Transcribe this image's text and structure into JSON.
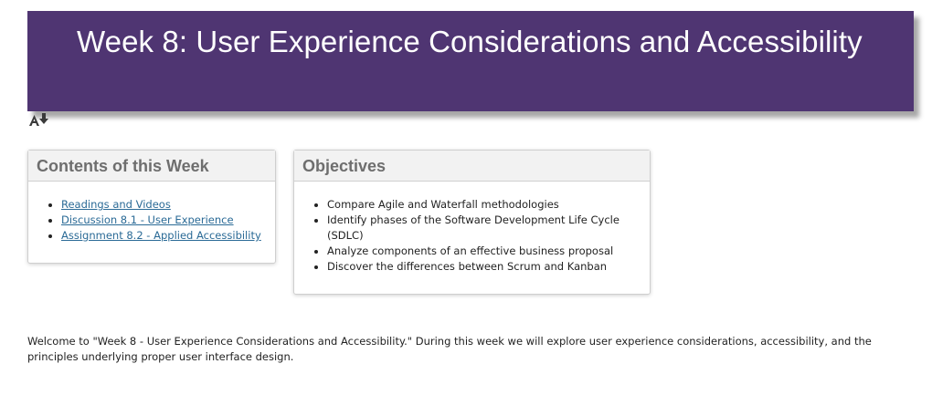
{
  "banner": {
    "title": "Week 8: User Experience Considerations and Accessibility",
    "background_color": "#4f3572"
  },
  "accessibility_icon": "accessibility-options-icon",
  "contents_card": {
    "title": "Contents of this Week",
    "links": [
      "Readings and Videos",
      "Discussion 8.1 - User Experience",
      "Assignment 8.2 - Applied Accessibility"
    ],
    "link_color": "#2a6a96"
  },
  "objectives_card": {
    "title": "Objectives",
    "items": [
      "Compare Agile and Waterfall methodologies",
      "Identify phases of the Software Development Life Cycle (SDLC)",
      "Analyze components of an effective business proposal",
      "Discover the differences between Scrum and Kanban"
    ]
  },
  "welcome_text": "Welcome to \"Week 8 - User Experience Considerations and Accessibility.\"  During this week we will explore user experience considerations, accessibility, and the principles underlying proper user interface design."
}
